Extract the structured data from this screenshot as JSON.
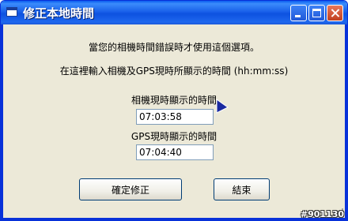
{
  "window": {
    "title": "修正本地時間"
  },
  "dialog": {
    "instruction_1": "當您的相機時間錯誤時才使用這個選項。",
    "instruction_2": "在這裡輸入相機及GPS現時所顯示的時間 (hh:mm:ss)",
    "camera_time_label": "相機現時顯示的時間",
    "camera_time_value": "07:03:58",
    "gps_time_label": "GPS現時顯示的時間",
    "gps_time_value": "07:04:40"
  },
  "buttons": {
    "confirm_label": "確定修正",
    "end_label": "結束"
  },
  "watermark": "#901130",
  "colors": {
    "titlebar": "#0a5bf0",
    "window_bg": "#ece9d8",
    "cursor": "#1a2aa0"
  },
  "icons": [
    "app-icon",
    "minimize-icon",
    "maximize-icon",
    "close-icon",
    "mouse-cursor-icon",
    "resize-grip-icon"
  ]
}
